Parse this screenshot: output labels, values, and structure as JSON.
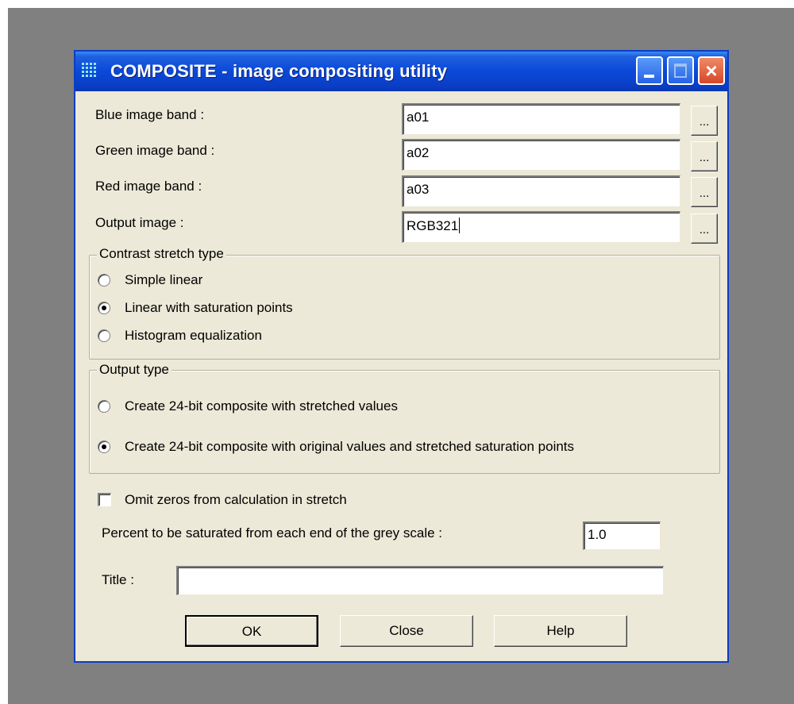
{
  "window": {
    "title": "COMPOSITE - image compositing utility",
    "icon": "grid-dots-icon",
    "controls": {
      "minimize": "minimize-icon",
      "maximize": "maximize-icon",
      "close": "×"
    }
  },
  "inputs": {
    "blue_label": "Blue image band :",
    "blue_value": "a01",
    "green_label": "Green image band :",
    "green_value": "a02",
    "red_label": "Red image band :",
    "red_value": "a03",
    "output_label": "Output image :",
    "output_value": "RGB321",
    "browse_label": "..."
  },
  "contrast": {
    "title": "Contrast stretch type",
    "options": [
      {
        "label": "Simple linear",
        "selected": false
      },
      {
        "label": "Linear with saturation points",
        "selected": true
      },
      {
        "label": "Histogram equalization",
        "selected": false
      }
    ]
  },
  "output_type": {
    "title": "Output type",
    "options": [
      {
        "label": "Create 24-bit composite with stretched values",
        "selected": false
      },
      {
        "label": "Create 24-bit composite with original values and stretched saturation points",
        "selected": true
      }
    ]
  },
  "omit_zeros": {
    "label": "Omit zeros from calculation in stretch",
    "checked": false
  },
  "percent": {
    "label": "Percent to be saturated from each end of the grey scale :",
    "value": "1.0"
  },
  "title_field": {
    "label": "Title :",
    "value": ""
  },
  "buttons": {
    "ok": "OK",
    "close": "Close",
    "help": "Help"
  },
  "colors": {
    "title_bar": "#0a49d8",
    "dialog_bg": "#ece9d8",
    "desktop": "#808080",
    "close_button": "#d6472a"
  }
}
